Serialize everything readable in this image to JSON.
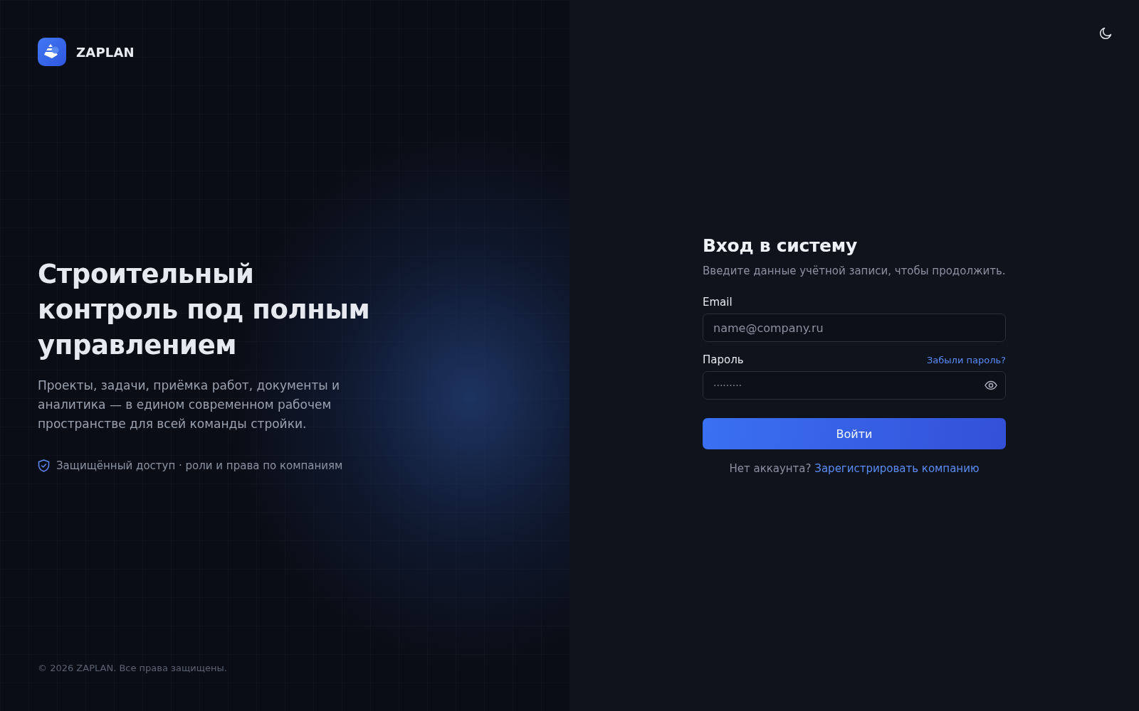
{
  "brand": {
    "name": "ZAPLAN"
  },
  "hero": {
    "title": "Строительный контроль под полным управлением",
    "description": "Проекты, задачи, приёмка работ, документы и аналитика — в едином современном рабочем пространстве для всей команды стройки.",
    "security_note": "Защищённый доступ · роли и права по компаниям"
  },
  "footer": {
    "copyright": "© 2026 ZAPLAN. Все права защищены."
  },
  "login_form": {
    "title": "Вход в систему",
    "subtitle": "Введите данные учётной записи, чтобы продолжить.",
    "fields": [
      {
        "kind": "email",
        "label": "Email",
        "placeholder": "name@company.ru"
      },
      {
        "kind": "password",
        "label": "Пароль",
        "placeholder": "·········",
        "link": "Забыли пароль?"
      }
    ],
    "submit": "Войти",
    "signup_prompt": "Нет аккаунта?",
    "signup_link": "Зарегистрировать компанию"
  }
}
